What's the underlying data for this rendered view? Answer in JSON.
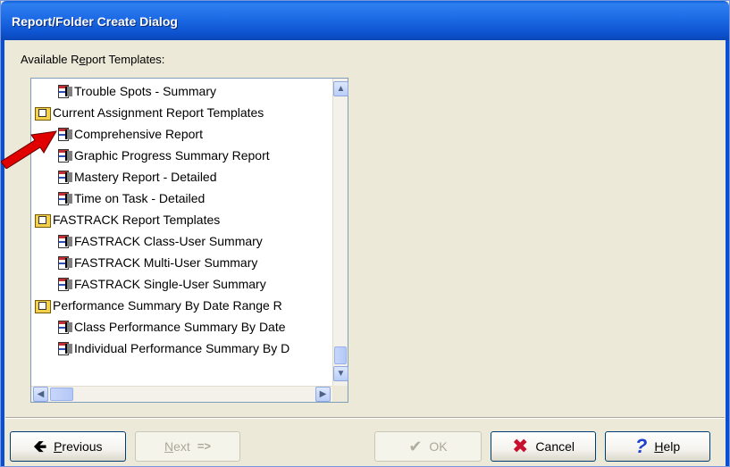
{
  "window": {
    "title": "Report/Folder Create Dialog"
  },
  "list": {
    "label_before": "Available R",
    "label_underline": "e",
    "label_after": "port Templates:",
    "items": [
      {
        "type": "doc",
        "indent": 1,
        "label": "Trouble Spots - Summary"
      },
      {
        "type": "folder",
        "indent": 0,
        "label": "Current Assignment Report Templates"
      },
      {
        "type": "doc",
        "indent": 1,
        "label": "Comprehensive Report"
      },
      {
        "type": "doc",
        "indent": 1,
        "label": "Graphic Progress Summary Report"
      },
      {
        "type": "doc",
        "indent": 1,
        "label": "Mastery Report - Detailed"
      },
      {
        "type": "doc",
        "indent": 1,
        "label": "Time on Task - Detailed"
      },
      {
        "type": "folder",
        "indent": 0,
        "label": "FASTRACK Report Templates"
      },
      {
        "type": "doc",
        "indent": 1,
        "label": "FASTRACK Class-User Summary"
      },
      {
        "type": "doc",
        "indent": 1,
        "label": "FASTRACK Multi-User Summary"
      },
      {
        "type": "doc",
        "indent": 1,
        "label": "FASTRACK Single-User Summary"
      },
      {
        "type": "folder",
        "indent": 0,
        "label": "Performance Summary By Date Range R"
      },
      {
        "type": "doc",
        "indent": 1,
        "label": "Class Performance Summary By Date"
      },
      {
        "type": "doc",
        "indent": 1,
        "label": "Individual Performance Summary By D"
      }
    ]
  },
  "buttons": {
    "previous": "Previous",
    "next": "Next",
    "ok": "OK",
    "cancel": "Cancel",
    "help": "Help"
  },
  "colors": {
    "accent": "#0a5fd8",
    "pointer": "#e00000"
  }
}
